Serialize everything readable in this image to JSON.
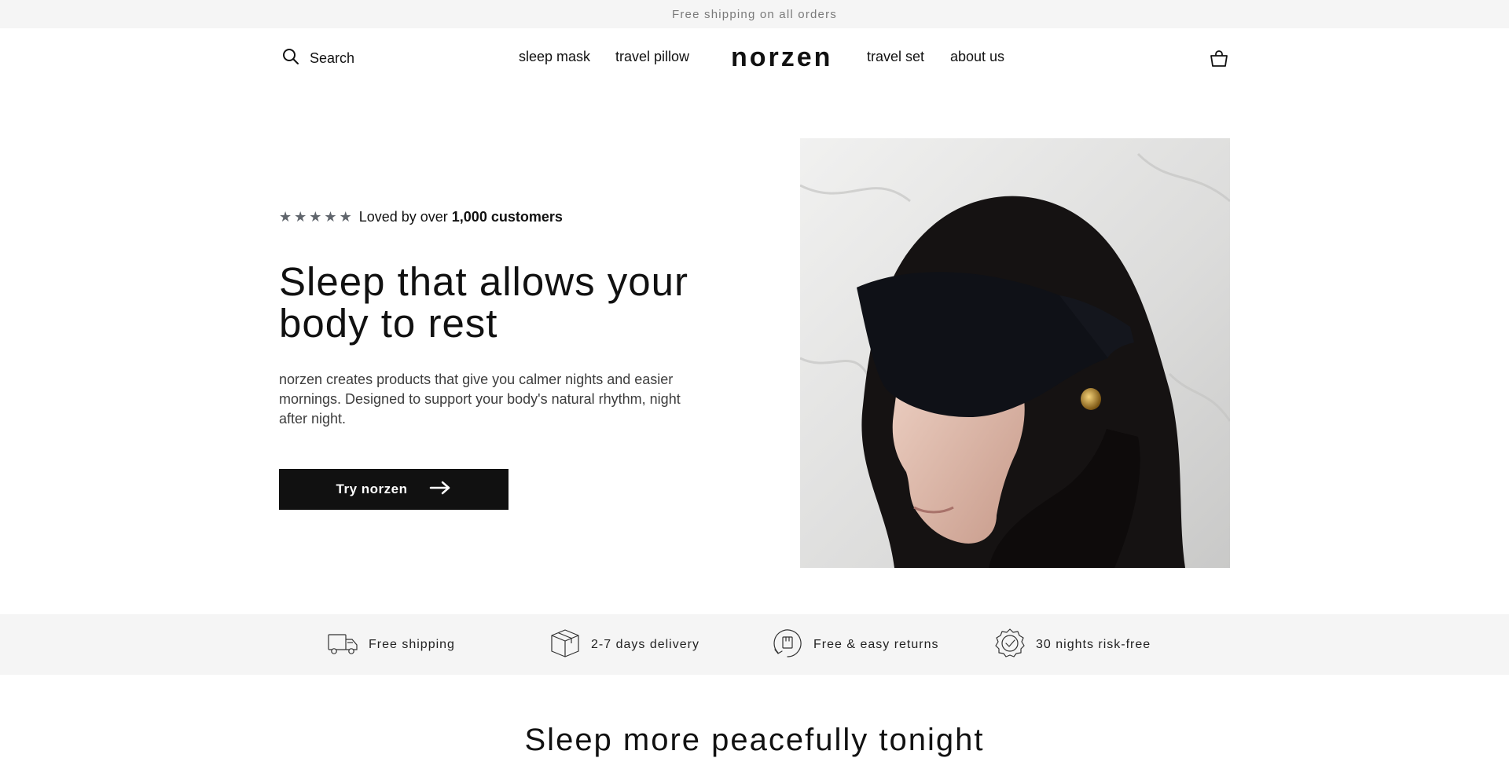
{
  "announcement": "Free shipping on all orders",
  "header": {
    "search_label": "Search",
    "logo": "norzen",
    "nav_left": [
      "sleep mask",
      "travel pillow"
    ],
    "nav_right": [
      "travel set",
      "about us"
    ]
  },
  "hero": {
    "rating_stars": 5,
    "rating_prefix": "Loved by over ",
    "rating_strong": "1,000 customers",
    "headline": "Sleep that allows your body to rest",
    "body": "norzen creates products that give you calmer nights and easier mornings. Designed to support your body's natural rhythm, night after night.",
    "cta_label": "Try norzen"
  },
  "features": [
    {
      "label": "Free shipping",
      "icon": "truck-icon"
    },
    {
      "label": "2-7 days delivery",
      "icon": "box-icon"
    },
    {
      "label": "Free & easy returns",
      "icon": "return-icon"
    },
    {
      "label": "30 nights risk-free",
      "icon": "badge-check-icon"
    }
  ],
  "section_title": "Sleep more peacefully tonight",
  "colors": {
    "announcement_bg": "#f5f5f5",
    "cta_bg": "#111111",
    "star": "#60656c",
    "features_bg": "#f5f5f5"
  }
}
